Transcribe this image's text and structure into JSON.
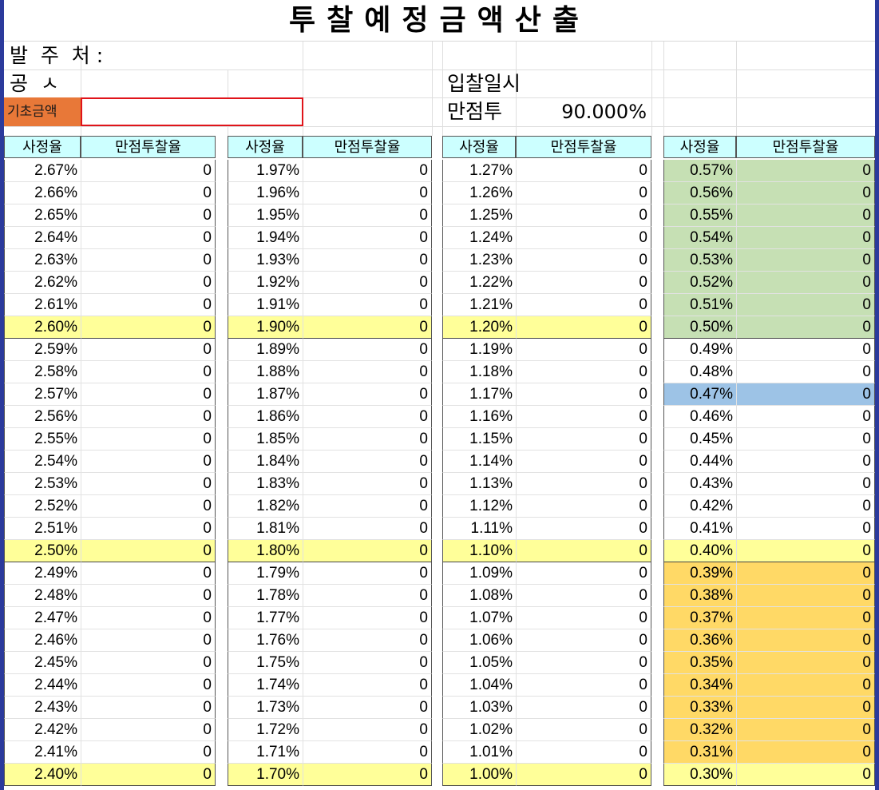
{
  "title": "투찰예정금액산출",
  "info": {
    "client_label": "발  주  처 :",
    "project_label": "공  ㅅ",
    "bid_date_label": "입찰일시",
    "base_amount_label": "기초금액",
    "base_amount_value": "",
    "full_score_label": "만점투",
    "full_score_value": "90.000%"
  },
  "column_headers": {
    "rate": "사정율",
    "ratio": "만점투찰율"
  },
  "blocks": [
    {
      "rates": [
        "2.67%",
        "2.66%",
        "2.65%",
        "2.64%",
        "2.63%",
        "2.62%",
        "2.61%",
        "2.60%",
        "2.59%",
        "2.58%",
        "2.57%",
        "2.56%",
        "2.55%",
        "2.54%",
        "2.53%",
        "2.52%",
        "2.51%",
        "2.50%",
        "2.49%",
        "2.48%",
        "2.47%",
        "2.46%",
        "2.45%",
        "2.44%",
        "2.43%",
        "2.42%",
        "2.41%",
        "2.40%"
      ],
      "values": [
        "0",
        "0",
        "0",
        "0",
        "0",
        "0",
        "0",
        "0",
        "0",
        "0",
        "0",
        "0",
        "0",
        "0",
        "0",
        "0",
        "0",
        "0",
        "0",
        "0",
        "0",
        "0",
        "0",
        "0",
        "0",
        "0",
        "0",
        "0"
      ],
      "fills": [
        "",
        "",
        "",
        "",
        "",
        "",
        "",
        "y",
        "",
        "",
        "",
        "",
        "",
        "",
        "",
        "",
        "",
        "y",
        "",
        "",
        "",
        "",
        "",
        "",
        "",
        "",
        "",
        "y"
      ]
    },
    {
      "rates": [
        "1.97%",
        "1.96%",
        "1.95%",
        "1.94%",
        "1.93%",
        "1.92%",
        "1.91%",
        "1.90%",
        "1.89%",
        "1.88%",
        "1.87%",
        "1.86%",
        "1.85%",
        "1.84%",
        "1.83%",
        "1.82%",
        "1.81%",
        "1.80%",
        "1.79%",
        "1.78%",
        "1.77%",
        "1.76%",
        "1.75%",
        "1.74%",
        "1.73%",
        "1.72%",
        "1.71%",
        "1.70%"
      ],
      "values": [
        "0",
        "0",
        "0",
        "0",
        "0",
        "0",
        "0",
        "0",
        "0",
        "0",
        "0",
        "0",
        "0",
        "0",
        "0",
        "0",
        "0",
        "0",
        "0",
        "0",
        "0",
        "0",
        "0",
        "0",
        "0",
        "0",
        "0",
        "0"
      ],
      "fills": [
        "",
        "",
        "",
        "",
        "",
        "",
        "",
        "y",
        "",
        "",
        "",
        "",
        "",
        "",
        "",
        "",
        "",
        "y",
        "",
        "",
        "",
        "",
        "",
        "",
        "",
        "",
        "",
        "y"
      ]
    },
    {
      "rates": [
        "1.27%",
        "1.26%",
        "1.25%",
        "1.24%",
        "1.23%",
        "1.22%",
        "1.21%",
        "1.20%",
        "1.19%",
        "1.18%",
        "1.17%",
        "1.16%",
        "1.15%",
        "1.14%",
        "1.13%",
        "1.12%",
        "1.11%",
        "1.10%",
        "1.09%",
        "1.08%",
        "1.07%",
        "1.06%",
        "1.05%",
        "1.04%",
        "1.03%",
        "1.02%",
        "1.01%",
        "1.00%"
      ],
      "values": [
        "0",
        "0",
        "0",
        "0",
        "0",
        "0",
        "0",
        "0",
        "0",
        "0",
        "0",
        "0",
        "0",
        "0",
        "0",
        "0",
        "0",
        "0",
        "0",
        "0",
        "0",
        "0",
        "0",
        "0",
        "0",
        "0",
        "0",
        "0"
      ],
      "fills": [
        "",
        "",
        "",
        "",
        "",
        "",
        "",
        "y",
        "",
        "",
        "",
        "",
        "",
        "",
        "",
        "",
        "",
        "y",
        "",
        "",
        "",
        "",
        "",
        "",
        "",
        "",
        "",
        "y"
      ]
    },
    {
      "rates": [
        "0.57%",
        "0.56%",
        "0.55%",
        "0.54%",
        "0.53%",
        "0.52%",
        "0.51%",
        "0.50%",
        "0.49%",
        "0.48%",
        "0.47%",
        "0.46%",
        "0.45%",
        "0.44%",
        "0.43%",
        "0.42%",
        "0.41%",
        "0.40%",
        "0.39%",
        "0.38%",
        "0.37%",
        "0.36%",
        "0.35%",
        "0.34%",
        "0.33%",
        "0.32%",
        "0.31%",
        "0.30%"
      ],
      "values": [
        "0",
        "0",
        "0",
        "0",
        "0",
        "0",
        "0",
        "0",
        "0",
        "0",
        "0",
        "0",
        "0",
        "0",
        "0",
        "0",
        "0",
        "0",
        "0",
        "0",
        "0",
        "0",
        "0",
        "0",
        "0",
        "0",
        "0",
        "0"
      ],
      "fills": [
        "g",
        "g",
        "g",
        "g",
        "g",
        "g",
        "g",
        "g",
        "",
        "",
        "b",
        "",
        "",
        "",
        "",
        "",
        "",
        "y",
        "a",
        "a",
        "a",
        "a",
        "a",
        "a",
        "a",
        "a",
        "a",
        "y"
      ]
    }
  ],
  "colors": {
    "header_fill": "#ccffff",
    "yellow": "#ffff99",
    "green": "#c6e0b4",
    "blue": "#9dc3e6",
    "amber": "#ffd966",
    "orange": "#e87838",
    "red_border": "#e0141a"
  }
}
